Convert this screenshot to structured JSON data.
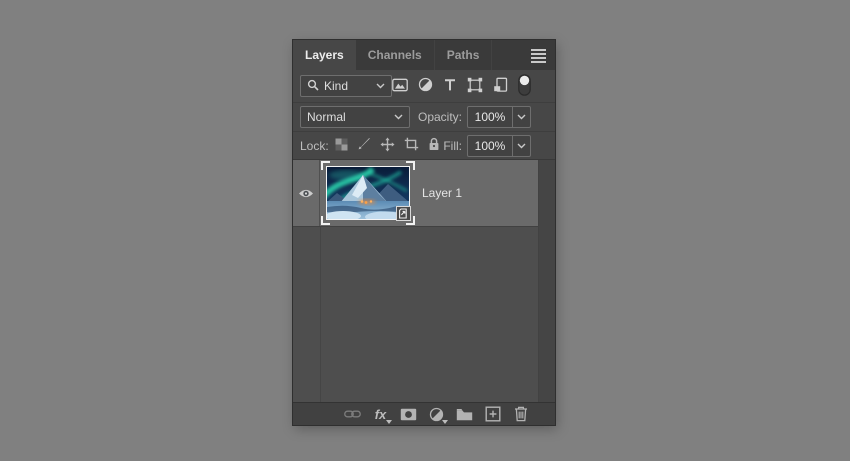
{
  "panel": {
    "tabs": [
      {
        "label": "Layers",
        "active": true
      },
      {
        "label": "Channels",
        "active": false
      },
      {
        "label": "Paths",
        "active": false
      }
    ],
    "panel_menu_icon": "hamburger-menu-icon",
    "filter_bar": {
      "search_icon": "magnifier-icon",
      "kind_label": "Kind",
      "type_filter_icons": [
        "pixel-layer-filter-icon",
        "adjustment-layer-filter-icon",
        "type-layer-filter-icon",
        "shape-layer-filter-icon",
        "smart-object-filter-icon"
      ],
      "filter_toggle_state": "off"
    },
    "blend_bar": {
      "blend_mode": "Normal",
      "opacity_label": "Opacity:",
      "opacity_value": "100%"
    },
    "lock_bar": {
      "label": "Lock:",
      "lock_icons": [
        "lock-transparent-pixels-icon",
        "lock-image-pixels-icon",
        "lock-position-icon",
        "lock-artboard-nesting-icon",
        "lock-all-icon"
      ],
      "fill_label": "Fill:",
      "fill_value": "100%"
    },
    "layers": [
      {
        "name": "Layer 1",
        "visible": true,
        "selected": true,
        "smart_object_badge": true,
        "thumbnail_description": "aurora-over-snowy-mountain-village"
      }
    ],
    "footer": {
      "fx_label": "fx",
      "icons": [
        "link-layers-icon",
        "layer-style-fx-icon",
        "add-layer-mask-icon",
        "new-adjustment-layer-icon",
        "new-group-icon",
        "new-layer-icon",
        "delete-layer-icon"
      ]
    }
  },
  "colors": {
    "canvas_background": "#808080",
    "panel_background": "#474747",
    "tab_strip": "#3a3a3a",
    "list_background": "#4e4e4e",
    "selected_row": "#6a6a6a",
    "field_border": "#6e6e6e",
    "footer_bar": "#414141",
    "text_primary": "#e8e8e8",
    "text_secondary": "#9c9c9c"
  }
}
